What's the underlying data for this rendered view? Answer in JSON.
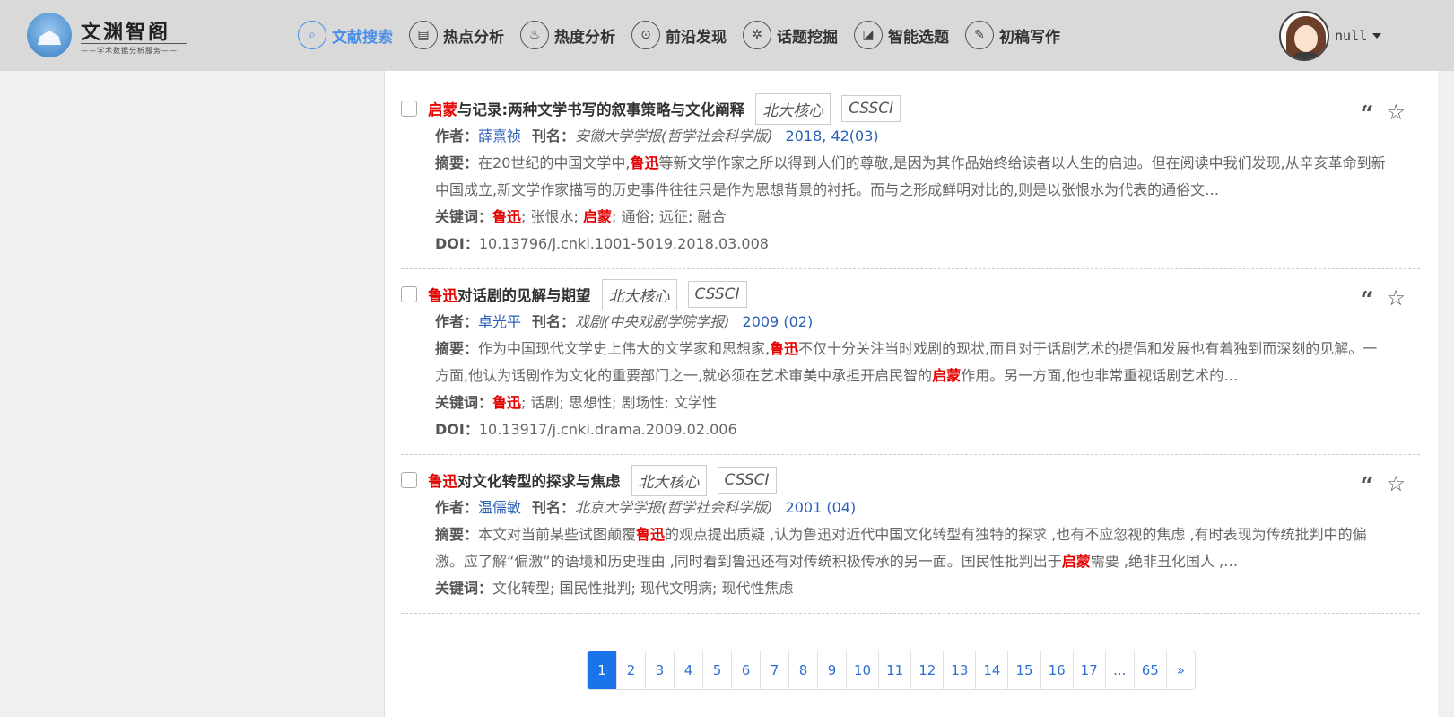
{
  "header": {
    "logo_title": "文渊智阁",
    "logo_subtitle": "——学术数据分析服务——",
    "nav": [
      {
        "label": "文献搜索",
        "icon": "search-icon",
        "active": true
      },
      {
        "label": "热点分析",
        "icon": "clipboard-icon",
        "active": false
      },
      {
        "label": "热度分析",
        "icon": "flame-icon",
        "active": false
      },
      {
        "label": "前沿发现",
        "icon": "location-pin-icon",
        "active": false
      },
      {
        "label": "话题挖掘",
        "icon": "gear-icon",
        "active": false
      },
      {
        "label": "智能选题",
        "icon": "book-icon",
        "active": false
      },
      {
        "label": "初稿写作",
        "icon": "pen-icon",
        "active": false
      }
    ],
    "username": "null"
  },
  "labels": {
    "author": "作者：",
    "journal": "刊名：",
    "abstract": "摘要：",
    "keywords": "关键词：",
    "doi": "DOI："
  },
  "results": [
    {
      "title_parts": [
        {
          "t": "启蒙",
          "hl": true
        },
        {
          "t": "与记录:两种文学书写的叙事策略与文化阐释",
          "hl": false
        }
      ],
      "tags": [
        "北大核心",
        "CSSCI"
      ],
      "author": "薛熹祯",
      "journal": "安徽大学学报(哲学社会科学版)",
      "year": "2018, 42(03)",
      "abstract_parts": [
        {
          "t": "在20世纪的中国文学中,",
          "hl": false
        },
        {
          "t": "鲁迅",
          "hl": true
        },
        {
          "t": "等新文学作家之所以得到人们的尊敬,是因为其作品始终给读者以人生的启迪。但在阅读中我们发现,从辛亥革命到新中国成立,新文学作家描写的历史事件往往只是作为思想背景的衬托。而与之形成鲜明对比的,则是以张恨水为代表的通俗文…",
          "hl": false
        }
      ],
      "keywords_parts": [
        {
          "t": "鲁迅",
          "hl": true
        },
        {
          "t": "; 张恨水; ",
          "hl": false
        },
        {
          "t": "启蒙",
          "hl": true
        },
        {
          "t": "; 通俗; 远征; 融合",
          "hl": false
        }
      ],
      "doi": "10.13796/j.cnki.1001-5019.2018.03.008"
    },
    {
      "title_parts": [
        {
          "t": "鲁迅",
          "hl": true
        },
        {
          "t": "对话剧的见解与期望",
          "hl": false
        }
      ],
      "tags": [
        "北大核心",
        "CSSCI"
      ],
      "author": "卓光平",
      "journal": "戏剧(中央戏剧学院学报)",
      "year": "2009 (02)",
      "abstract_parts": [
        {
          "t": "作为中国现代文学史上伟大的文学家和思想家,",
          "hl": false
        },
        {
          "t": "鲁迅",
          "hl": true
        },
        {
          "t": "不仅十分关注当时戏剧的现状,而且对于话剧艺术的提倡和发展也有着独到而深刻的见解。一方面,他认为话剧作为文化的重要部门之一,就必须在艺术审美中承担开启民智的",
          "hl": false
        },
        {
          "t": "启蒙",
          "hl": true
        },
        {
          "t": "作用。另一方面,他也非常重视话剧艺术的…",
          "hl": false
        }
      ],
      "keywords_parts": [
        {
          "t": "鲁迅",
          "hl": true
        },
        {
          "t": "; 话剧; 思想性; 剧场性; 文学性",
          "hl": false
        }
      ],
      "doi": "10.13917/j.cnki.drama.2009.02.006"
    },
    {
      "title_parts": [
        {
          "t": "鲁迅",
          "hl": true
        },
        {
          "t": "对文化转型的探求与焦虑",
          "hl": false
        }
      ],
      "tags": [
        "北大核心",
        "CSSCI"
      ],
      "author": "温儒敏",
      "journal": "北京大学学报(哲学社会科学版)",
      "year": "2001 (04)",
      "abstract_parts": [
        {
          "t": "本文对当前某些试图颠覆",
          "hl": false
        },
        {
          "t": "鲁迅",
          "hl": true
        },
        {
          "t": "的观点提出质疑 ,认为鲁迅对近代中国文化转型有独特的探求 ,也有不应忽视的焦虑 ,有时表现为传统批判中的偏激。应了解“偏激”的语境和历史理由 ,同时看到鲁迅还有对传统积极传承的另一面。国民性批判出于",
          "hl": false
        },
        {
          "t": "启蒙",
          "hl": true
        },
        {
          "t": "需要 ,绝非丑化国人 ,…",
          "hl": false
        }
      ],
      "keywords_parts": [
        {
          "t": "文化转型; 国民性批判; 现代文明病; 现代性焦虑",
          "hl": false
        }
      ],
      "doi": null
    }
  ],
  "pagination": {
    "pages": [
      "1",
      "2",
      "3",
      "4",
      "5",
      "6",
      "7",
      "8",
      "9",
      "10",
      "11",
      "12",
      "13",
      "14",
      "15",
      "16",
      "17",
      "...",
      "65",
      "»"
    ],
    "current": "1"
  },
  "colors": {
    "accent": "#1a73e8",
    "highlight": "#e60000",
    "link": "#2a60b8",
    "header_bg": "#d9d9d9"
  }
}
